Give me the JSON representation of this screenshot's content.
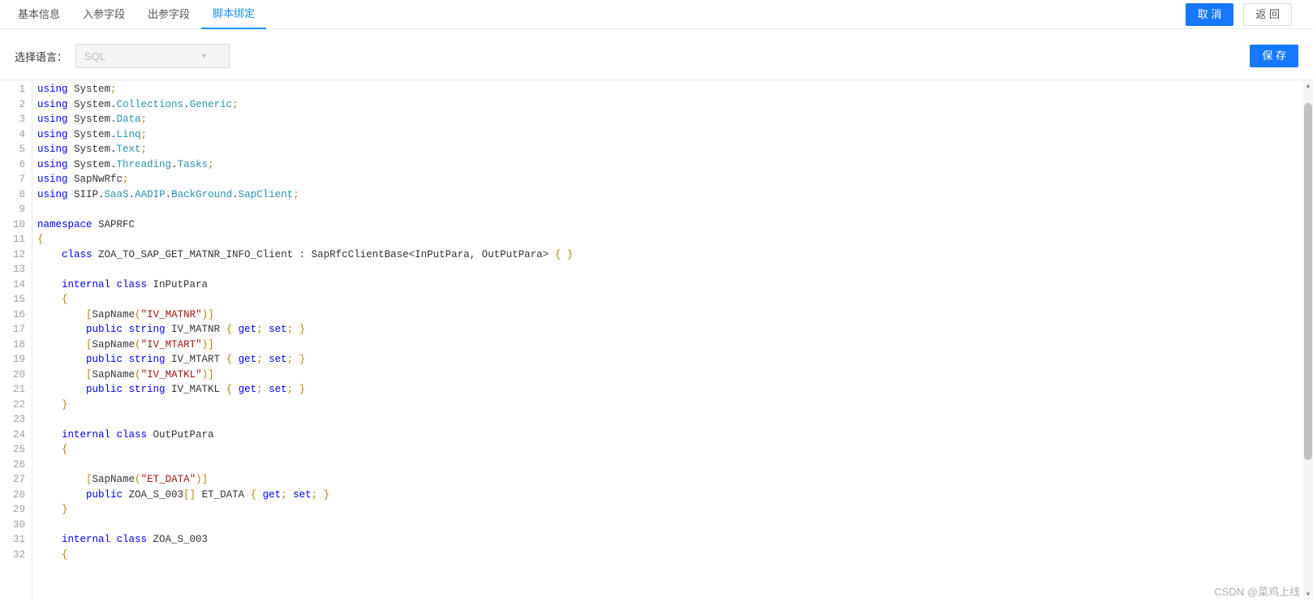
{
  "tabs": {
    "items": [
      {
        "label": "基本信息",
        "active": false
      },
      {
        "label": "入参字段",
        "active": false
      },
      {
        "label": "出参字段",
        "active": false
      },
      {
        "label": "脚本绑定",
        "active": true
      }
    ]
  },
  "header": {
    "cancel": "取 消",
    "back": "返 回"
  },
  "toolbar": {
    "lang_label": "选择语言：",
    "lang_value": "SQL",
    "save": "保 存"
  },
  "code": {
    "lines": [
      [
        [
          "kw",
          "using"
        ],
        [
          "plain",
          " System"
        ],
        [
          "gold",
          ";"
        ]
      ],
      [
        [
          "kw",
          "using"
        ],
        [
          "plain",
          " System."
        ],
        [
          "typ",
          "Collections"
        ],
        [
          "plain",
          "."
        ],
        [
          "typ",
          "Generic"
        ],
        [
          "gold",
          ";"
        ]
      ],
      [
        [
          "kw",
          "using"
        ],
        [
          "plain",
          " System."
        ],
        [
          "typ",
          "Data"
        ],
        [
          "gold",
          ";"
        ]
      ],
      [
        [
          "kw",
          "using"
        ],
        [
          "plain",
          " System."
        ],
        [
          "typ",
          "Linq"
        ],
        [
          "gold",
          ";"
        ]
      ],
      [
        [
          "kw",
          "using"
        ],
        [
          "plain",
          " System."
        ],
        [
          "typ",
          "Text"
        ],
        [
          "gold",
          ";"
        ]
      ],
      [
        [
          "kw",
          "using"
        ],
        [
          "plain",
          " System."
        ],
        [
          "typ",
          "Threading"
        ],
        [
          "plain",
          "."
        ],
        [
          "typ",
          "Tasks"
        ],
        [
          "gold",
          ";"
        ]
      ],
      [
        [
          "kw",
          "using"
        ],
        [
          "plain",
          " SapNwRfc"
        ],
        [
          "gold",
          ";"
        ]
      ],
      [
        [
          "kw",
          "using"
        ],
        [
          "plain",
          " SIIP."
        ],
        [
          "typ",
          "SaaS"
        ],
        [
          "plain",
          "."
        ],
        [
          "typ",
          "AADIP"
        ],
        [
          "plain",
          "."
        ],
        [
          "typ",
          "BackGround"
        ],
        [
          "plain",
          "."
        ],
        [
          "typ",
          "SapClient"
        ],
        [
          "gold",
          ";"
        ]
      ],
      [],
      [
        [
          "kw",
          "namespace"
        ],
        [
          "plain",
          " SAPRFC"
        ]
      ],
      [
        [
          "gold",
          "{"
        ]
      ],
      [
        [
          "plain",
          "    "
        ],
        [
          "kw",
          "class"
        ],
        [
          "plain",
          " ZOA_TO_SAP_GET_MATNR_INFO_Client : SapRfcClientBase<InPutPara, OutPutPara> "
        ],
        [
          "gold",
          "{ }"
        ]
      ],
      [],
      [
        [
          "plain",
          "    "
        ],
        [
          "kw",
          "internal class"
        ],
        [
          "plain",
          " InPutPara"
        ]
      ],
      [
        [
          "plain",
          "    "
        ],
        [
          "gold",
          "{"
        ]
      ],
      [
        [
          "plain",
          "        "
        ],
        [
          "gold",
          "["
        ],
        [
          "plain",
          "SapName"
        ],
        [
          "gold",
          "("
        ],
        [
          "str",
          "\"IV_MATNR\""
        ],
        [
          "gold",
          ")]"
        ]
      ],
      [
        [
          "plain",
          "        "
        ],
        [
          "kw",
          "public string"
        ],
        [
          "plain",
          " IV_MATNR "
        ],
        [
          "gold",
          "{"
        ],
        [
          "plain",
          " "
        ],
        [
          "kw",
          "get"
        ],
        [
          "gold",
          ";"
        ],
        [
          "plain",
          " "
        ],
        [
          "kw",
          "set"
        ],
        [
          "gold",
          "; }"
        ]
      ],
      [
        [
          "plain",
          "        "
        ],
        [
          "gold",
          "["
        ],
        [
          "plain",
          "SapName"
        ],
        [
          "gold",
          "("
        ],
        [
          "str",
          "\"IV_MTART\""
        ],
        [
          "gold",
          ")]"
        ]
      ],
      [
        [
          "plain",
          "        "
        ],
        [
          "kw",
          "public string"
        ],
        [
          "plain",
          " IV_MTART "
        ],
        [
          "gold",
          "{"
        ],
        [
          "plain",
          " "
        ],
        [
          "kw",
          "get"
        ],
        [
          "gold",
          ";"
        ],
        [
          "plain",
          " "
        ],
        [
          "kw",
          "set"
        ],
        [
          "gold",
          "; }"
        ]
      ],
      [
        [
          "plain",
          "        "
        ],
        [
          "gold",
          "["
        ],
        [
          "plain",
          "SapName"
        ],
        [
          "gold",
          "("
        ],
        [
          "str",
          "\"IV_MATKL\""
        ],
        [
          "gold",
          ")]"
        ]
      ],
      [
        [
          "plain",
          "        "
        ],
        [
          "kw",
          "public string"
        ],
        [
          "plain",
          " IV_MATKL "
        ],
        [
          "gold",
          "{"
        ],
        [
          "plain",
          " "
        ],
        [
          "kw",
          "get"
        ],
        [
          "gold",
          ";"
        ],
        [
          "plain",
          " "
        ],
        [
          "kw",
          "set"
        ],
        [
          "gold",
          "; }"
        ]
      ],
      [
        [
          "plain",
          "    "
        ],
        [
          "gold",
          "}"
        ]
      ],
      [],
      [
        [
          "plain",
          "    "
        ],
        [
          "kw",
          "internal class"
        ],
        [
          "plain",
          " OutPutPara"
        ]
      ],
      [
        [
          "plain",
          "    "
        ],
        [
          "gold",
          "{"
        ]
      ],
      [],
      [
        [
          "plain",
          "        "
        ],
        [
          "gold",
          "["
        ],
        [
          "plain",
          "SapName"
        ],
        [
          "gold",
          "("
        ],
        [
          "str",
          "\"ET_DATA\""
        ],
        [
          "gold",
          ")]"
        ]
      ],
      [
        [
          "plain",
          "        "
        ],
        [
          "kw",
          "public"
        ],
        [
          "plain",
          " ZOA_S_003"
        ],
        [
          "gold",
          "[]"
        ],
        [
          "plain",
          " ET_DATA "
        ],
        [
          "gold",
          "{"
        ],
        [
          "plain",
          " "
        ],
        [
          "kw",
          "get"
        ],
        [
          "gold",
          ";"
        ],
        [
          "plain",
          " "
        ],
        [
          "kw",
          "set"
        ],
        [
          "gold",
          "; }"
        ]
      ],
      [
        [
          "plain",
          "    "
        ],
        [
          "gold",
          "}"
        ]
      ],
      [],
      [
        [
          "plain",
          "    "
        ],
        [
          "kw",
          "internal class"
        ],
        [
          "plain",
          " ZOA_S_003"
        ]
      ],
      [
        [
          "plain",
          "    "
        ],
        [
          "gold",
          "{"
        ]
      ]
    ]
  },
  "watermark": "CSDN @菜鸡上线"
}
